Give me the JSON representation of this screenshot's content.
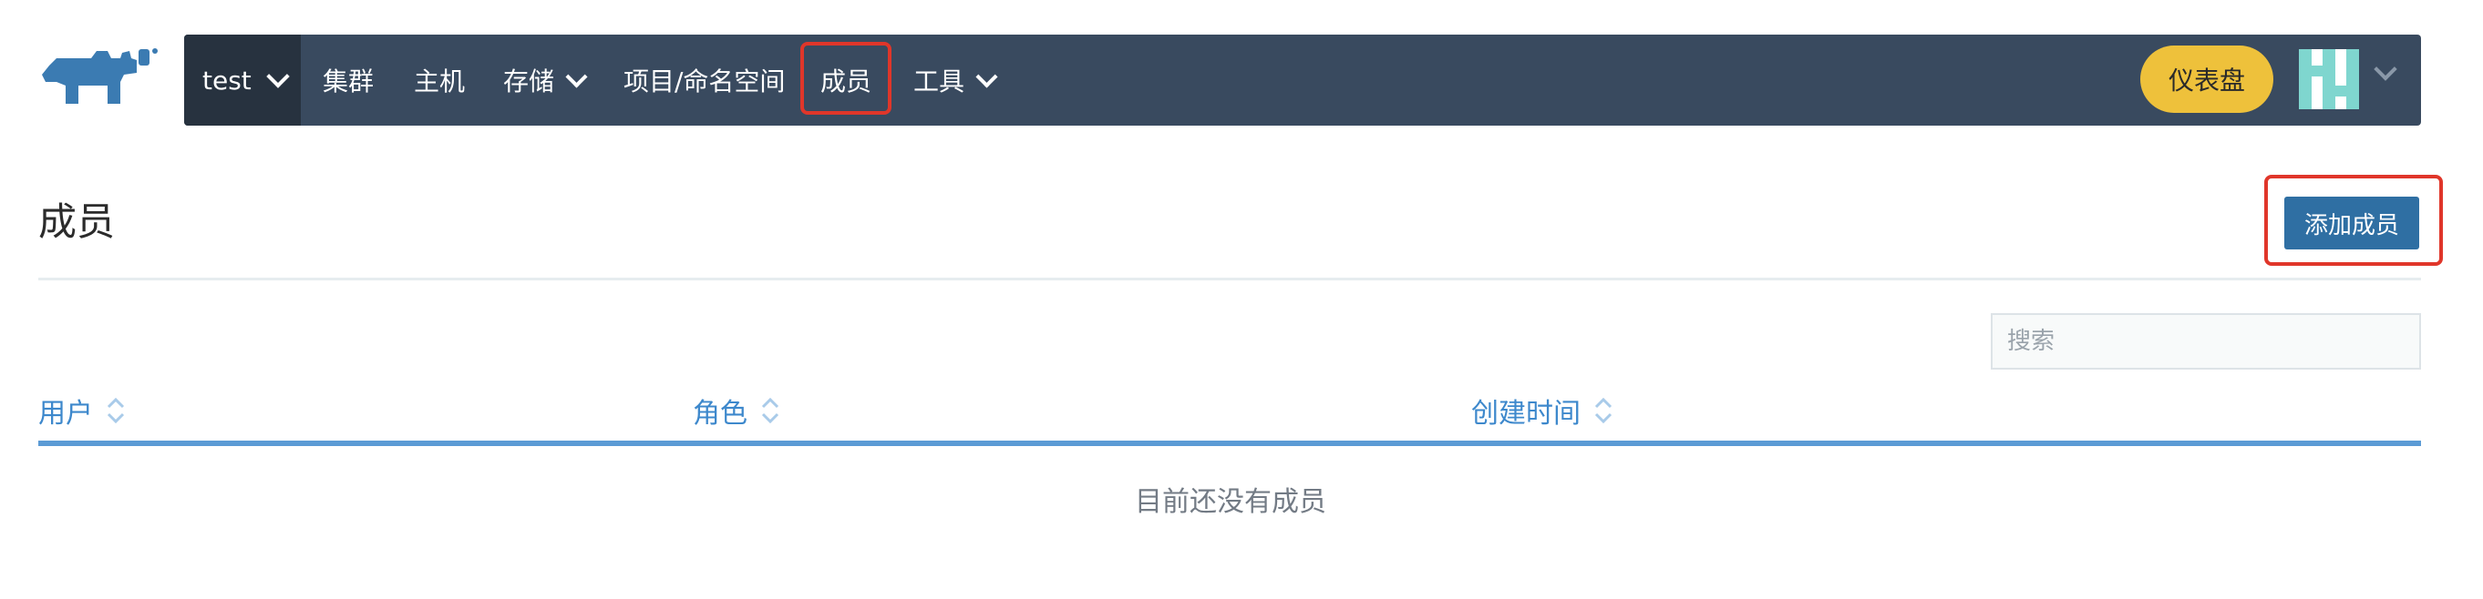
{
  "header": {
    "logo_icon": "rancher-cow-logo-icon",
    "env": {
      "label": "test",
      "icon": "chevron-down-icon"
    },
    "nav": [
      {
        "label": "集群",
        "has_dropdown": false
      },
      {
        "label": "主机",
        "has_dropdown": false
      },
      {
        "label": "存储",
        "has_dropdown": true
      },
      {
        "label": "项目/命名空间",
        "has_dropdown": false
      },
      {
        "label": "成员",
        "has_dropdown": false,
        "highlighted": true
      },
      {
        "label": "工具",
        "has_dropdown": true
      }
    ],
    "dashboard_label": "仪表盘",
    "avatar_icon": "user-avatar-icon",
    "colors": {
      "navbar": "#394a5f",
      "env_bg": "#27323f",
      "dashboard": "#eec13b",
      "highlight": "#e0362a"
    }
  },
  "main": {
    "title": "成员",
    "add_button_label": "添加成员",
    "search": {
      "placeholder": "搜索",
      "value": ""
    },
    "table": {
      "columns": [
        {
          "label": "用户",
          "sortable": true
        },
        {
          "label": "角色",
          "sortable": true
        },
        {
          "label": "创建时间",
          "sortable": true
        }
      ],
      "rows": [],
      "empty_message": "目前还没有成员"
    },
    "colors": {
      "accent": "#3d88cc",
      "button": "#2f6fa3"
    }
  }
}
